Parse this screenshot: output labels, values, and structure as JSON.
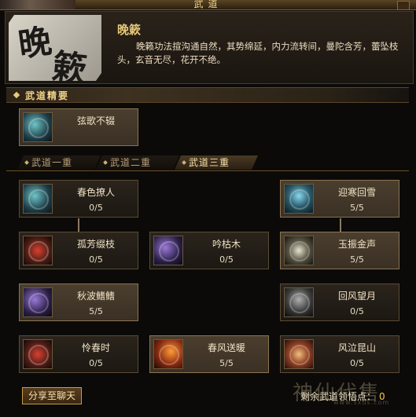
{
  "window": {
    "title": "武道"
  },
  "header": {
    "emblem_text": "晚簌",
    "name": "晚簌",
    "description": "晚籁功法揎沟通自然，其势绵延，内力流转间，曼陀含芳，蕾坠枝头，玄音无尽，花开不绝。"
  },
  "essence": {
    "label": "武道精要",
    "skill": {
      "name": "弦歌不辍"
    }
  },
  "tabs": [
    {
      "label": "武道一重",
      "active": false
    },
    {
      "label": "武道二重",
      "active": false
    },
    {
      "label": "武道三重",
      "active": true
    }
  ],
  "skills": [
    {
      "name": "春色撩人",
      "level": "0/5",
      "icon": "skill-icon-teal"
    },
    {
      "name": "迎寒回雪",
      "level": "5/5",
      "icon": "skill-icon-ice"
    },
    {
      "name": "孤芳缀枝",
      "level": "0/5",
      "icon": "skill-icon-red"
    },
    {
      "name": "吟枯木",
      "level": "0/5",
      "icon": "skill-icon-purple"
    },
    {
      "name": "玉振金声",
      "level": "5/5",
      "icon": "skill-icon-white"
    },
    {
      "name": "秋波鳍鳍",
      "level": "5/5",
      "icon": "skill-icon-purple"
    },
    {
      "name": "回风望月",
      "level": "0/5",
      "icon": "skill-icon-gray"
    },
    {
      "name": "怜春时",
      "level": "0/5",
      "icon": "skill-icon-red"
    },
    {
      "name": "春风送暖",
      "level": "5/5",
      "icon": "skill-icon-fire"
    },
    {
      "name": "风泣昆山",
      "level": "0/5",
      "icon": "skill-icon-orange"
    }
  ],
  "footer": {
    "share_label": "分享至聊天",
    "points_label": "剩余武道领悟点：",
    "points_value": "0",
    "watermark": "神仙代售",
    "watermark_sub": "www.sxds.com"
  }
}
